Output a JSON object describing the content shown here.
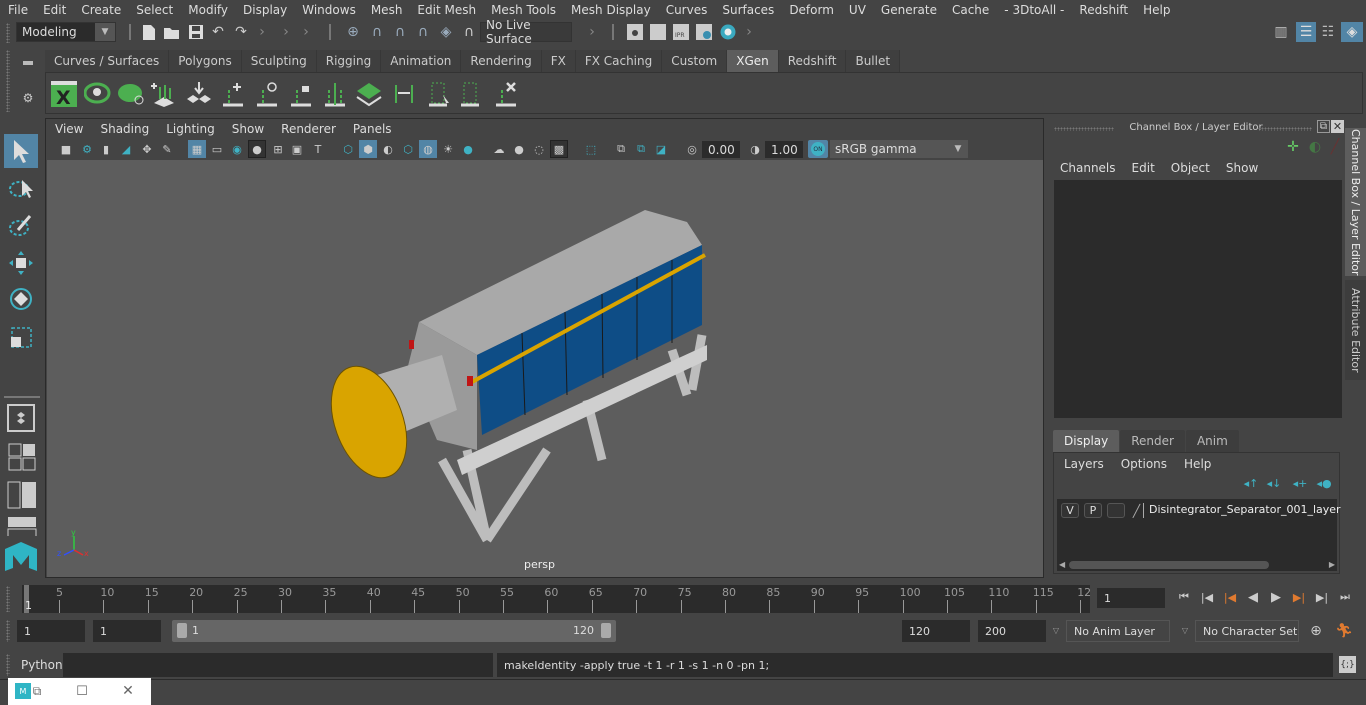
{
  "menubar": {
    "items": [
      "File",
      "Edit",
      "Create",
      "Select",
      "Modify",
      "Display",
      "Windows",
      "Mesh",
      "Edit Mesh",
      "Mesh Tools",
      "Mesh Display",
      "Curves",
      "Surfaces",
      "Deform",
      "UV",
      "Generate",
      "Cache",
      "- 3DtoAll -",
      "Redshift",
      "Help"
    ]
  },
  "statusline": {
    "mode": "Modeling",
    "live_surface": "No Live Surface",
    "icons": [
      "new-scene-icon",
      "open-scene-icon",
      "save-scene-icon",
      "undo-icon",
      "redo-icon",
      "snap-grid-icon",
      "snap-curve-icon",
      "snap-point-icon",
      "snap-view-plane-icon",
      "snap-live-icon",
      "make-live-icon",
      "render-view-icon",
      "render-frame-icon",
      "ipr-render-icon",
      "render-settings-icon",
      "hypershade-icon"
    ],
    "right_icons": [
      "modeling-toolkit-icon",
      "attribute-editor-toggle-icon",
      "tool-settings-icon",
      "channel-box-toggle-icon"
    ]
  },
  "shelf": {
    "tabs": [
      "Curves / Surfaces",
      "Polygons",
      "Sculpting",
      "Rigging",
      "Animation",
      "Rendering",
      "FX",
      "FX Caching",
      "Custom",
      "XGen",
      "Redshift",
      "Bullet"
    ],
    "active_tab": "XGen",
    "icons": [
      "xgen-editor-icon",
      "xgen-preview-icon",
      "xgen-clear-preview-icon",
      "xgen-add-guide-icon",
      "xgen-place-guide-icon",
      "xgen-add-guide-single-icon",
      "xgen-show-guide-icon",
      "xgen-lock-guide-icon",
      "xgen-split-guide-icon",
      "xgen-density-icon",
      "xgen-flip-icon",
      "xgen-select-guides-icon",
      "xgen-bound-guide-icon",
      "xgen-delete-guide-icon"
    ]
  },
  "toolbox": {
    "tools": [
      "select-tool-icon",
      "lasso-select-icon",
      "paint-select-icon",
      "move-tool-icon",
      "rotate-tool-icon",
      "scale-tool-icon"
    ],
    "layouts": [
      "single-pane-layout-icon",
      "four-pane-layout-icon",
      "outliner-persp-layout-icon",
      "persp-graph-layout-icon"
    ]
  },
  "viewport": {
    "menus": [
      "View",
      "Shading",
      "Lighting",
      "Show",
      "Renderer",
      "Panels"
    ],
    "exposure": "0.00",
    "gamma": "1.00",
    "color_mgmt": "ON",
    "color_space": "sRGB gamma",
    "camera_label": "persp",
    "axis": {
      "x": "x",
      "y": "y",
      "z": "z"
    }
  },
  "channel_box": {
    "title": "Channel Box / Layer Editor",
    "menus": [
      "Channels",
      "Edit",
      "Object",
      "Show"
    ]
  },
  "layer_editor": {
    "tabs": [
      "Display",
      "Render",
      "Anim"
    ],
    "active_tab": "Display",
    "menus": [
      "Layers",
      "Options",
      "Help"
    ],
    "layers": [
      {
        "v": "V",
        "p": "P",
        "name": "Disintegrator_Separator_001_layer"
      }
    ]
  },
  "side_tabs": [
    "Channel Box / Layer Editor",
    "Attribute Editor"
  ],
  "timeline": {
    "ticks": [
      5,
      10,
      15,
      20,
      25,
      30,
      35,
      40,
      45,
      50,
      55,
      60,
      65,
      70,
      75,
      80,
      85,
      90,
      95,
      100,
      105,
      110,
      115,
      "12"
    ],
    "current_marker": "1",
    "current_frame": "1"
  },
  "range": {
    "start": "1",
    "playback_start": "1",
    "slider_start": "1",
    "slider_end": "120",
    "playback_end": "120",
    "end": "200",
    "anim_layer": "No Anim Layer",
    "character_set": "No Character Set"
  },
  "command_line": {
    "language": "Python",
    "input": "",
    "result": "makeIdentity -apply true -t 1 -r 1 -s 1 -n 0 -pn 1;"
  },
  "colors": {
    "accent": "#5285a6",
    "machine_blue": "#0e4d86",
    "machine_yellow": "#d9a400",
    "playhead": "#e07a30"
  }
}
